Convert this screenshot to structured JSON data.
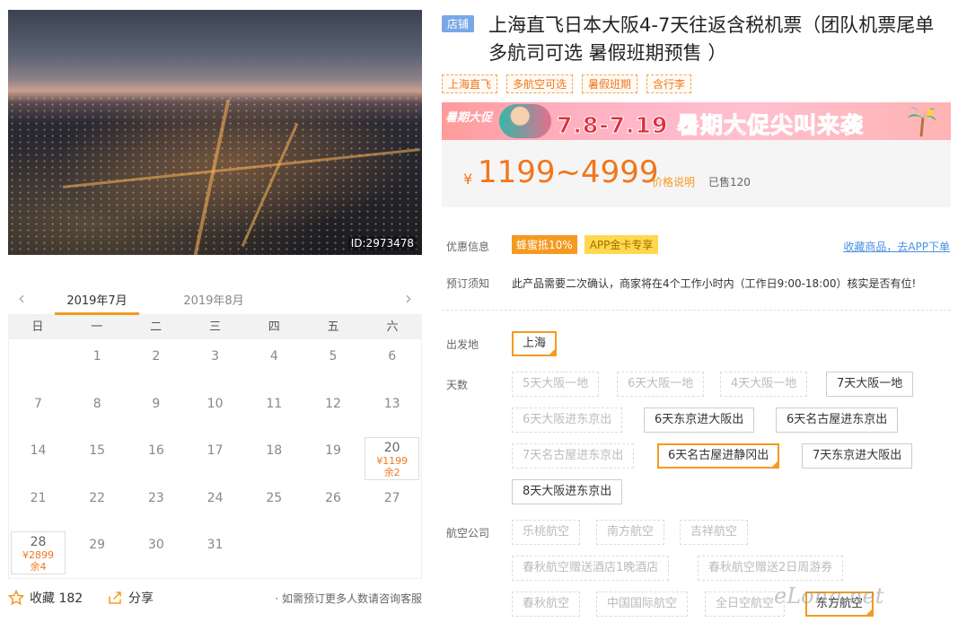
{
  "hero": {
    "image_id": "ID:2973478"
  },
  "calendar": {
    "prev_icon": "‹",
    "next_icon": "›",
    "months": [
      "2019年7月",
      "2019年8月"
    ],
    "weekdays": [
      "日",
      "一",
      "二",
      "三",
      "四",
      "五",
      "六"
    ],
    "days": [
      {
        "day": "1",
        "col": 1,
        "row": 0
      },
      {
        "day": "2",
        "col": 2,
        "row": 0
      },
      {
        "day": "3",
        "col": 3,
        "row": 0
      },
      {
        "day": "4",
        "col": 4,
        "row": 0
      },
      {
        "day": "5",
        "col": 5,
        "row": 0
      },
      {
        "day": "6",
        "col": 6,
        "row": 0
      },
      {
        "day": "7",
        "col": 0,
        "row": 1
      },
      {
        "day": "8",
        "col": 1,
        "row": 1
      },
      {
        "day": "9",
        "col": 2,
        "row": 1
      },
      {
        "day": "10",
        "col": 3,
        "row": 1
      },
      {
        "day": "11",
        "col": 4,
        "row": 1
      },
      {
        "day": "12",
        "col": 5,
        "row": 1
      },
      {
        "day": "13",
        "col": 6,
        "row": 1
      },
      {
        "day": "14",
        "col": 0,
        "row": 2
      },
      {
        "day": "15",
        "col": 1,
        "row": 2
      },
      {
        "day": "16",
        "col": 2,
        "row": 2
      },
      {
        "day": "17",
        "col": 3,
        "row": 2
      },
      {
        "day": "18",
        "col": 4,
        "row": 2
      },
      {
        "day": "19",
        "col": 5,
        "row": 2
      },
      {
        "day": "20",
        "col": 6,
        "row": 2,
        "price": "¥1199",
        "remain": "余2"
      },
      {
        "day": "21",
        "col": 0,
        "row": 3
      },
      {
        "day": "22",
        "col": 1,
        "row": 3
      },
      {
        "day": "23",
        "col": 2,
        "row": 3
      },
      {
        "day": "24",
        "col": 3,
        "row": 3
      },
      {
        "day": "25",
        "col": 4,
        "row": 3
      },
      {
        "day": "26",
        "col": 5,
        "row": 3
      },
      {
        "day": "27",
        "col": 6,
        "row": 3
      },
      {
        "day": "28",
        "col": 0,
        "row": 4,
        "price": "¥2899",
        "remain": "余4"
      },
      {
        "day": "29",
        "col": 1,
        "row": 4
      },
      {
        "day": "30",
        "col": 2,
        "row": 4
      },
      {
        "day": "31",
        "col": 3,
        "row": 4
      }
    ],
    "favorite_label": "收藏 182",
    "share_label": "分享",
    "consult_text": "· 如需预订更多人数请咨询客服"
  },
  "product": {
    "store_tag": "店铺",
    "title": "上海直飞日本大阪4-7天往返含税机票（团队机票尾单 多航司可选 暑假班期预售 ）",
    "feature_tags": [
      "上海直飞",
      "多航空可选",
      "暑假班期",
      "含行李"
    ],
    "banner": {
      "badge": "暑期大促",
      "text": "7.8-7.19 暑期大促尖叫来袭"
    },
    "price": {
      "currency": "¥",
      "range": "1199~4999",
      "note": "价格说明",
      "sold": "已售120"
    },
    "promo": {
      "label": "优惠信息",
      "tags": [
        "蜂蜜抵10%",
        "APP金卡专享"
      ],
      "favorite_app": "收藏商品，去APP下单"
    },
    "notice": {
      "label": "预订须知",
      "text": "此产品需要二次确认，商家将在4个工作小时内（工作日9:00-18:00）核实是否有位!"
    },
    "departure": {
      "label": "出发地",
      "options": [
        {
          "text": "上海",
          "state": "sel"
        }
      ]
    },
    "days": {
      "label": "天数",
      "options": [
        {
          "text": "5天大阪一地",
          "state": "dis"
        },
        {
          "text": "6天大阪一地",
          "state": "dis"
        },
        {
          "text": "4天大阪一地",
          "state": "dis"
        },
        {
          "text": "7天大阪一地",
          "state": "ok"
        },
        {
          "text": "6天大阪进东京出",
          "state": "dis"
        },
        {
          "text": "6天东京进大阪出",
          "state": "ok"
        },
        {
          "text": "6天名古屋进东京出",
          "state": "ok"
        },
        {
          "text": "7天名古屋进东京出",
          "state": "dis"
        },
        {
          "text": "6天名古屋进静冈出",
          "state": "sel"
        },
        {
          "text": "7天东京进大阪出",
          "state": "ok"
        },
        {
          "text": "8天大阪进东京出",
          "state": "ok"
        }
      ]
    },
    "airlines": {
      "label": "航空公司",
      "options": [
        {
          "text": "乐桃航空",
          "state": "dis"
        },
        {
          "text": "南方航空",
          "state": "dis"
        },
        {
          "text": "吉祥航空",
          "state": "dis"
        },
        {
          "text": "春秋航空赠送酒店1晚酒店",
          "state": "dis"
        },
        {
          "text": "春秋航空赠送2日周游券",
          "state": "dis"
        },
        {
          "text": "春秋航空",
          "state": "dis"
        },
        {
          "text": "中国国际航空",
          "state": "dis"
        },
        {
          "text": "全日空航空",
          "state": "dis"
        },
        {
          "text": "东方航空",
          "state": "sel"
        }
      ]
    }
  },
  "watermark": "eLong.net",
  "colors": {
    "accent": "#f49a1f",
    "price": "#f1761d",
    "link": "#4a90e2",
    "store_tag": "#79a7e8"
  }
}
